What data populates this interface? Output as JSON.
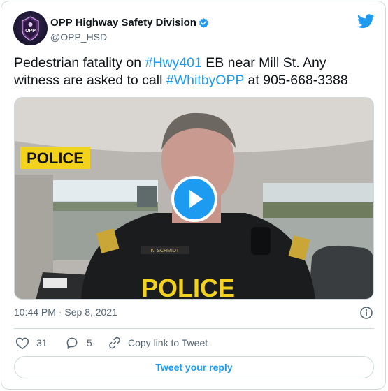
{
  "header": {
    "name": "OPP Highway Safety Division",
    "handle": "@OPP_HSD",
    "avatar_text": "OPP",
    "icons": {
      "verified": "verified-badge-icon",
      "brand": "twitter-bird-icon"
    }
  },
  "tweet": {
    "text_parts": [
      {
        "text": "Pedestrian fatality on ",
        "link": false
      },
      {
        "text": "#Hwy401",
        "link": true
      },
      {
        "text": " EB near Mill St. Any witness are asked to call ",
        "link": false
      },
      {
        "text": "#WhitbyOPP",
        "link": true
      },
      {
        "text": " at 905-668-3388",
        "link": false
      }
    ]
  },
  "media": {
    "banner_text": "POLICE",
    "vest_text": "POLICE",
    "nametag": "K. SCHMIDT",
    "icon": "play-icon"
  },
  "meta": {
    "time": "10:44 PM",
    "separator": " · ",
    "date": "Sep 8, 2021",
    "icon": "info-icon"
  },
  "actions": {
    "likes": "31",
    "replies": "5",
    "copy_label": "Copy link to Tweet",
    "icons": [
      "heart-icon",
      "reply-bubble-icon",
      "link-icon"
    ]
  },
  "reply_button": {
    "label": "Tweet your reply"
  },
  "colors": {
    "accent": "#1d9bf0",
    "text": "#0f1419",
    "muted": "#536471",
    "border": "#cfd9de"
  }
}
